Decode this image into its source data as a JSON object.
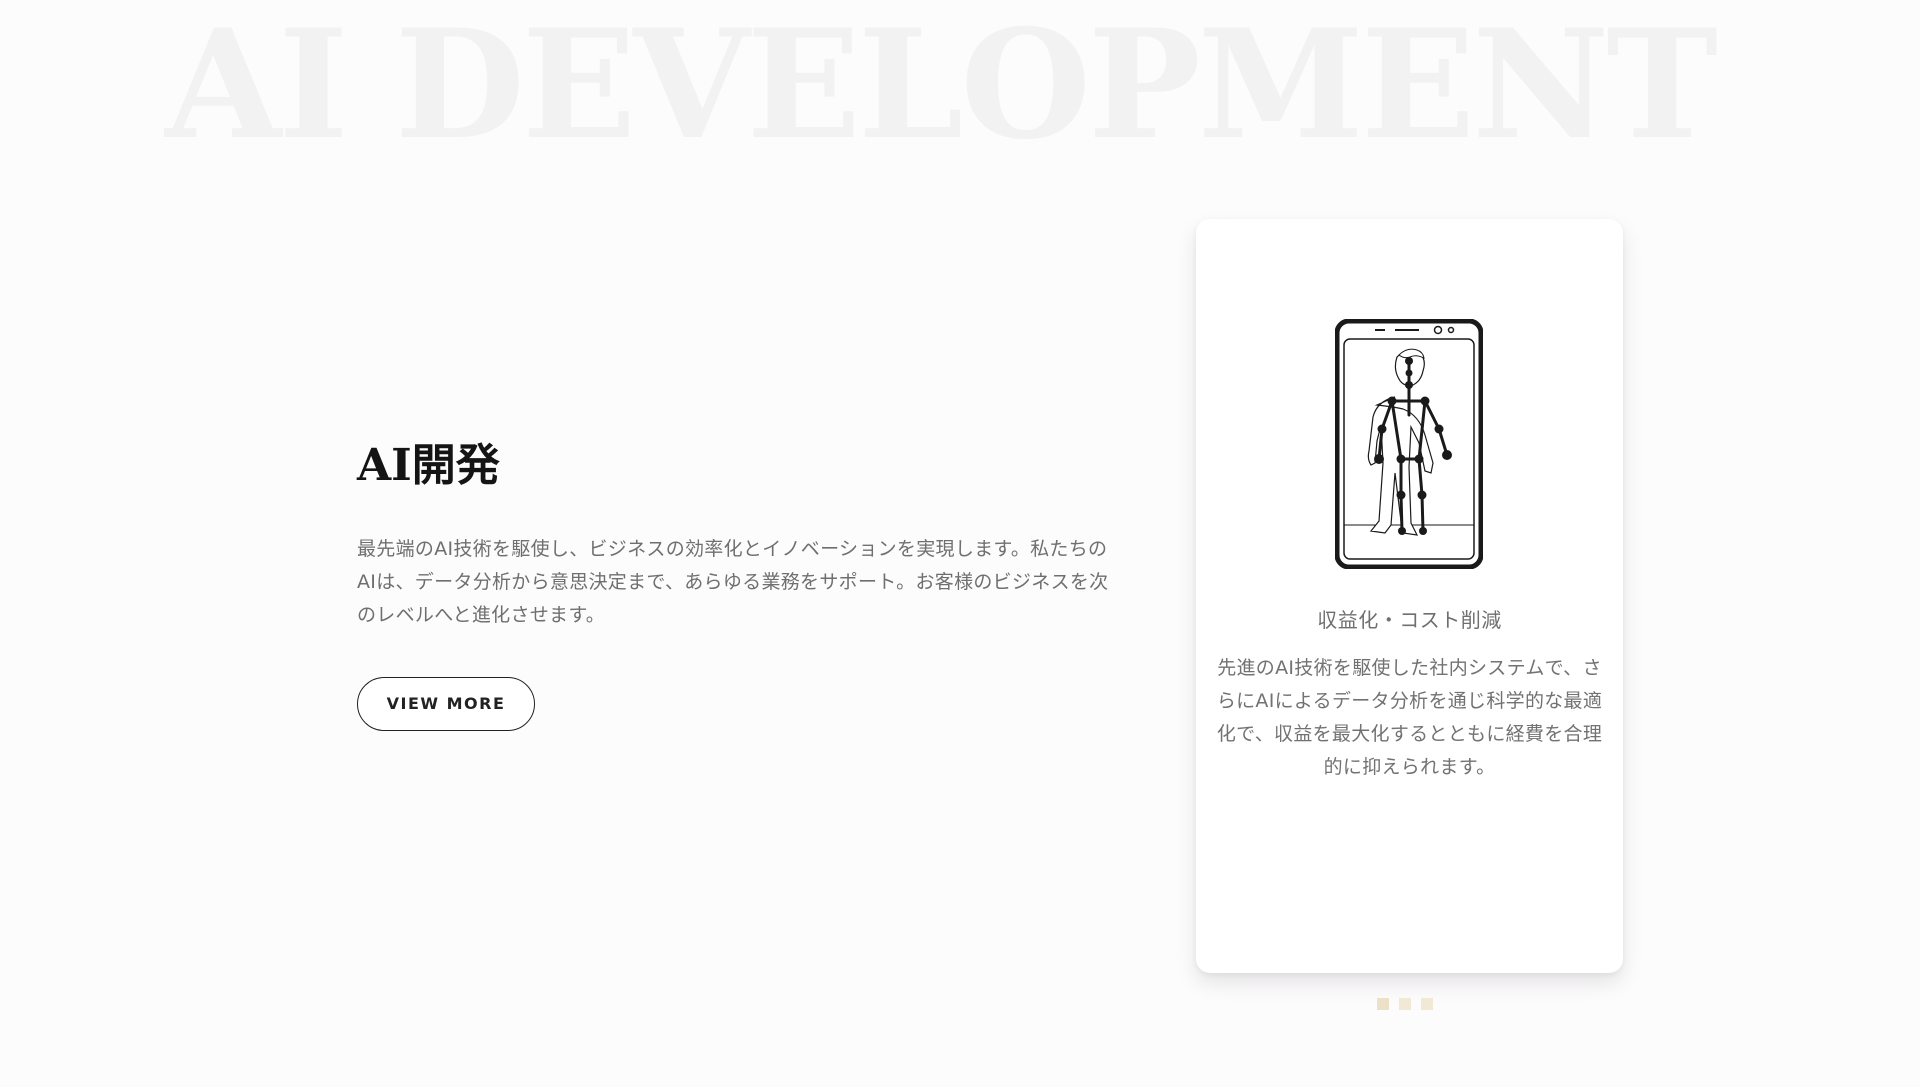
{
  "background_title": "AI DEVELOPMENT",
  "section": {
    "heading": "AI開発",
    "description": "最先端のAI技術を駆使し、ビジネスの効率化とイノベーションを実現します。私たちのAIは、データ分析から意思決定まで、あらゆる業務をサポート。お客様のビジネスを次のレベルへと進化させます。",
    "button_label": "VIEW MORE"
  },
  "card": {
    "icon": "smartphone-pose-estimation-icon",
    "title": "収益化・コスト削減",
    "text": "先進のAI技術を駆使した社内システムで、さらにAIによるデータ分析を通じ科学的な最適化で、収益を最大化するとともに経費を合理的に抑えられます。"
  },
  "carousel": {
    "dot_count": 3,
    "active_index": 0
  },
  "colors": {
    "background": "#fdfcfd",
    "background_title": "#f2f2f2",
    "heading": "#141414",
    "body_text": "#6f6f6f",
    "dot": "#f1e8d6"
  }
}
